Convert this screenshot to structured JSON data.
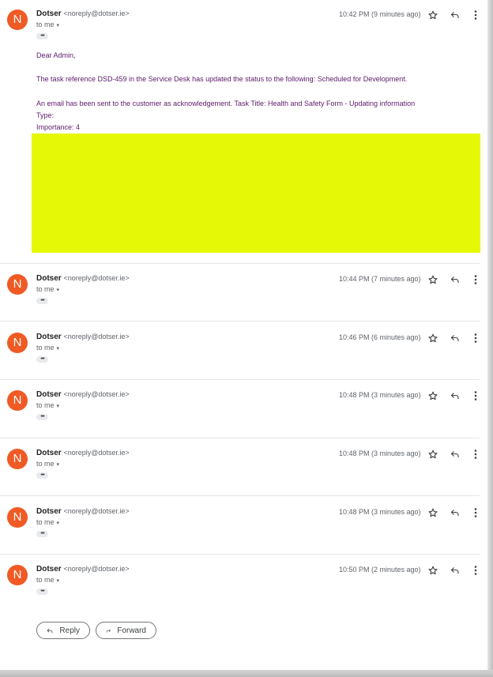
{
  "thread": {
    "messages": [
      {
        "avatar_letter": "N",
        "sender_name": "Dotser",
        "sender_email": "<noreply@dotser.ie>",
        "recipient": "to me",
        "time": "10:42 PM (9 minutes ago)",
        "expanded": true,
        "body": {
          "greeting": "Dear Admin,",
          "line1": "The task reference DSD-459 in the Service Desk has updated the status to the following: Scheduled for Development.",
          "line2": "An email has been sent to the customer as acknowledgement. Task Title: Health and Safety Form - Updating information",
          "type_label": "Type:",
          "importance": "Importance: 4"
        },
        "highlight_color": "#e5f907"
      },
      {
        "avatar_letter": "N",
        "sender_name": "Dotser",
        "sender_email": "<noreply@dotser.ie>",
        "recipient": "to me",
        "time": "10:44 PM (7 minutes ago)"
      },
      {
        "avatar_letter": "N",
        "sender_name": "Dotser",
        "sender_email": "<noreply@dotser.ie>",
        "recipient": "to me",
        "time": "10:46 PM (6 minutes ago)"
      },
      {
        "avatar_letter": "N",
        "sender_name": "Dotser",
        "sender_email": "<noreply@dotser.ie>",
        "recipient": "to me",
        "time": "10:48 PM (3 minutes ago)"
      },
      {
        "avatar_letter": "N",
        "sender_name": "Dotser",
        "sender_email": "<noreply@dotser.ie>",
        "recipient": "to me",
        "time": "10:48 PM (3 minutes ago)"
      },
      {
        "avatar_letter": "N",
        "sender_name": "Dotser",
        "sender_email": "<noreply@dotser.ie>",
        "recipient": "to me",
        "time": "10:48 PM (3 minutes ago)"
      },
      {
        "avatar_letter": "N",
        "sender_name": "Dotser",
        "sender_email": "<noreply@dotser.ie>",
        "recipient": "to me",
        "time": "10:50 PM (2 minutes ago)"
      }
    ],
    "trimmed_content_label": "•••",
    "icons": {
      "star": "star-icon",
      "reply": "reply-icon",
      "more": "more-vert-icon",
      "caret": "▾"
    }
  },
  "actions": {
    "reply_label": "Reply",
    "forward_label": "Forward"
  },
  "colors": {
    "avatar": "#f05a24",
    "body_text": "#5c1a6b",
    "highlight": "#e5f907"
  }
}
